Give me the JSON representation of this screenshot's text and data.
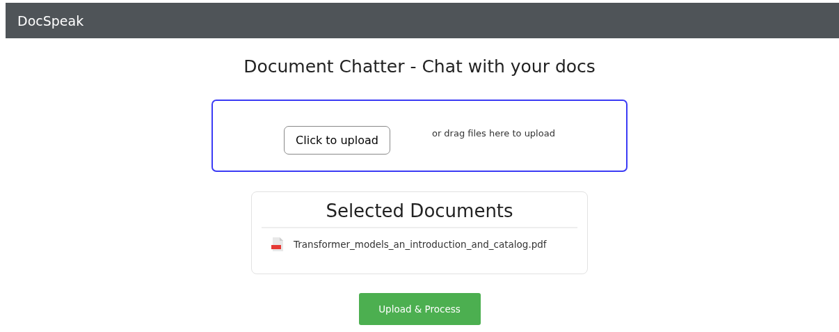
{
  "navbar": {
    "brand": "DocSpeak"
  },
  "title": "Document Chatter - Chat with your docs",
  "dropzone": {
    "button": "Click to upload",
    "hint": "or drag files here to upload"
  },
  "selected_documents": {
    "heading": "Selected Documents",
    "files": [
      {
        "name": "Transformer_models_an_introduction_and_catalog.pdf",
        "kind": "pdf"
      }
    ]
  },
  "action_button": "Upload & Process"
}
